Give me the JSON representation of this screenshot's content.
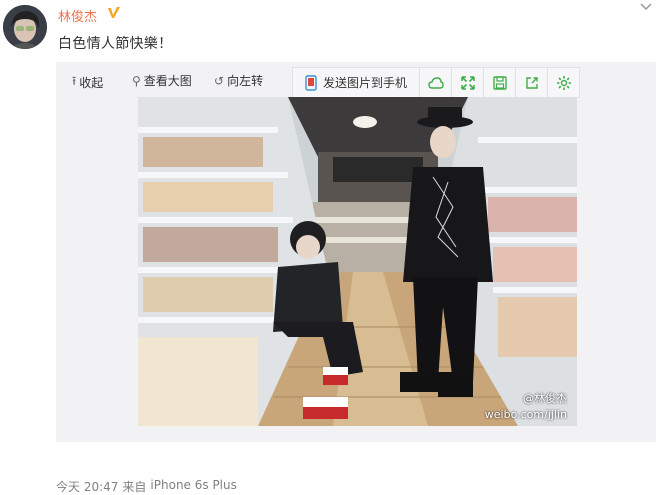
{
  "user": {
    "name": "林俊杰",
    "verified_icon": "verified-v-badge-icon",
    "accent": "#eb7350"
  },
  "post": {
    "text": "白色情人節快樂！"
  },
  "media_toolbar": {
    "collapse": "收起",
    "view_large": "查看大图",
    "rotate_left": "向左转"
  },
  "overlay_toolbar": {
    "send_to_phone": "发送图片到手机",
    "icons": [
      "cloud-icon",
      "expand-icon",
      "save-icon",
      "share-icon",
      "settings-icon"
    ],
    "icon_color": "#3fae49"
  },
  "photo": {
    "watermark_name": "@林俊杰",
    "watermark_url": "weibo.com/jjlin"
  },
  "footer": {
    "time": "今天 20:47",
    "source_prefix": "来自",
    "source": "iPhone 6s Plus"
  }
}
